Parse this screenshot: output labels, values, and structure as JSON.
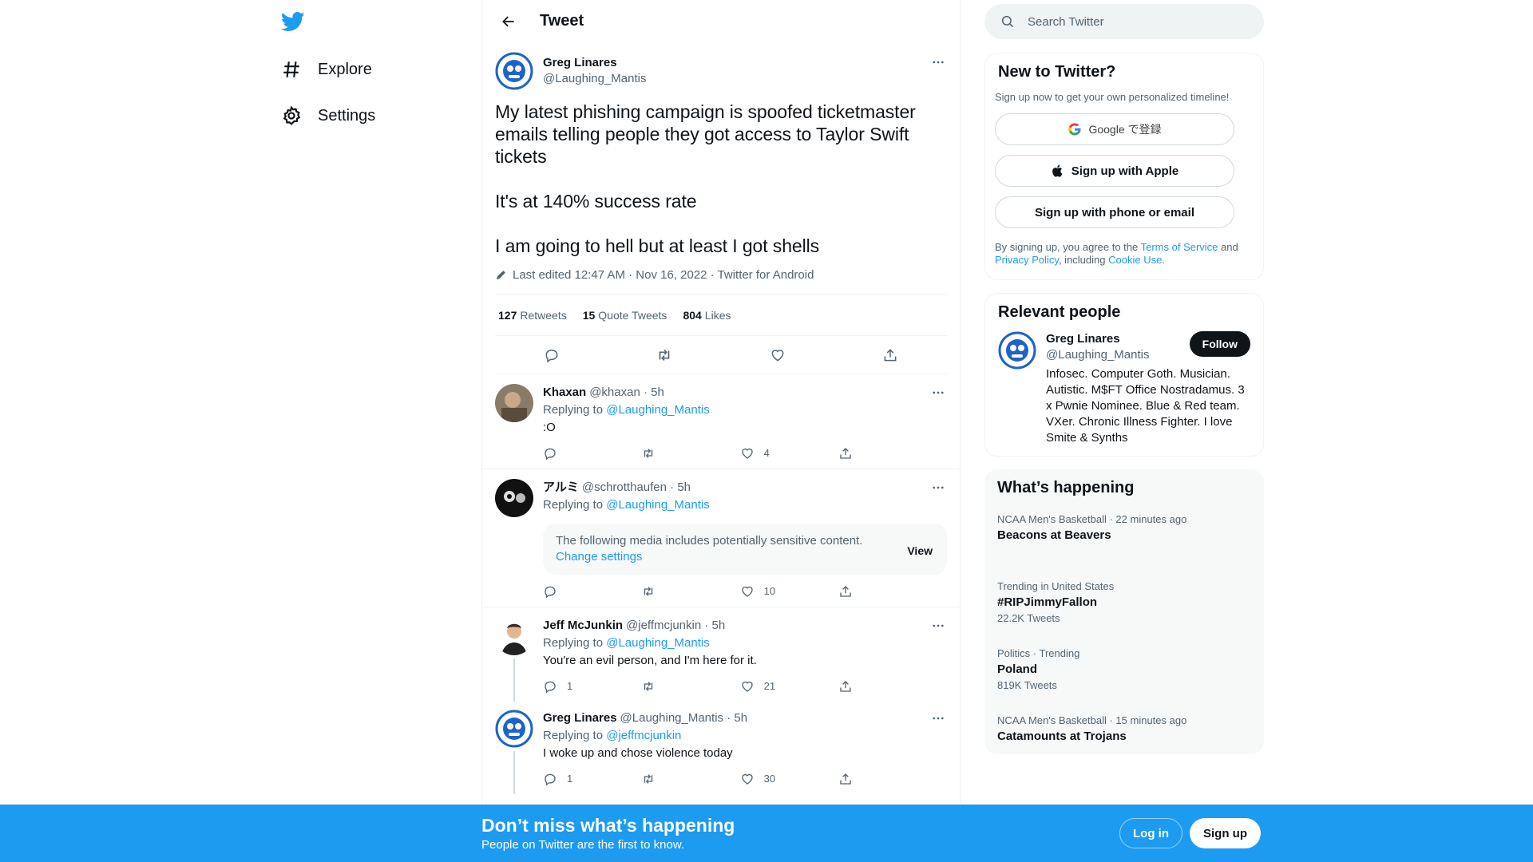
{
  "nav": {
    "logo": "twitter-bird-icon",
    "explore": "Explore",
    "settings": "Settings"
  },
  "header": {
    "title": "Tweet"
  },
  "focal_tweet": {
    "name": "Greg Linares",
    "handle": "@Laughing_Mantis",
    "text": "My latest phishing campaign is spoofed ticketmaster emails telling people they got access to Taylor Swift tickets\n\nIt's at 140% success rate\n\nI am going to hell but at least I got shells",
    "edited": "Last edited 12:47 AM · Nov 16, 2022 · Twitter for Android",
    "retweets": "127",
    "retweets_label": "Retweets",
    "quotes": "15",
    "quotes_label": "Quote Tweets",
    "likes": "804",
    "likes_label": "Likes"
  },
  "replies": [
    {
      "name": "Khaxan",
      "handle": "@khaxan",
      "time": "5h",
      "replying_prefix": "Replying to",
      "replying_to": "@Laughing_Mantis",
      "text": ":O",
      "replies": "",
      "retweets": "",
      "likes": "4"
    },
    {
      "name": "アルミ",
      "handle": "@schrotthaufen",
      "time": "5h",
      "replying_prefix": "Replying to",
      "replying_to": "@Laughing_Mantis",
      "sensitive_text": "The following media includes potentially sensitive content.",
      "sensitive_link": "Change settings",
      "sensitive_view": "View",
      "replies": "",
      "retweets": "",
      "likes": "10"
    },
    {
      "name": "Jeff McJunkin",
      "handle": "@jeffmcjunkin",
      "time": "5h",
      "replying_prefix": "Replying to",
      "replying_to": "@Laughing_Mantis",
      "text": "You're an evil person, and I'm here for it.",
      "replies": "1",
      "retweets": "",
      "likes": "21"
    },
    {
      "name": "Greg Linares",
      "handle": "@Laughing_Mantis",
      "time": "5h",
      "replying_prefix": "Replying to",
      "replying_to": "@jeffmcjunkin",
      "text": "I woke up and chose violence today",
      "replies": "1",
      "retweets": "",
      "likes": "30"
    }
  ],
  "search": {
    "placeholder": "Search Twitter"
  },
  "new_to_twitter": {
    "title": "New to Twitter?",
    "subtitle": "Sign up now to get your own personalized timeline!",
    "google": "Google で登録",
    "apple": "Sign up with Apple",
    "phone": "Sign up with phone or email",
    "legal_1": "By signing up, you agree to the ",
    "terms": "Terms of Service",
    "legal_2": " and ",
    "privacy": "Privacy Policy",
    "legal_3": ", including ",
    "cookie": "Cookie Use."
  },
  "relevant_people": {
    "title": "Relevant people",
    "name": "Greg Linares",
    "handle": "@Laughing_Mantis",
    "follow": "Follow",
    "bio": "Infosec. Computer Goth. Musician. Autistic. M$FT Office Nostradamus. 3 x Pwnie Nominee. Blue & Red team. VXer. Chronic Illness Fighter. I love Smite & Synths"
  },
  "happening": {
    "title": "What’s happening",
    "trends": [
      {
        "meta": "NCAA Men's Basketball · 22 minutes ago",
        "topic": "Beacons at Beavers",
        "count": ""
      },
      {
        "meta": "Trending in United States",
        "topic": "#RIPJimmyFallon",
        "count": "22.2K Tweets"
      },
      {
        "meta": "Politics · Trending",
        "topic": "Poland",
        "count": "819K Tweets"
      },
      {
        "meta": "NCAA Men's Basketball · 15 minutes ago",
        "topic": "Catamounts at Trojans",
        "count": ""
      }
    ]
  },
  "banner": {
    "title": "Don’t miss what’s happening",
    "subtitle": "People on Twitter are the first to know.",
    "login": "Log in",
    "signup": "Sign up"
  },
  "colors": {
    "accent": "#1d9bf0",
    "text": "#0f1419",
    "muted": "#536471"
  }
}
